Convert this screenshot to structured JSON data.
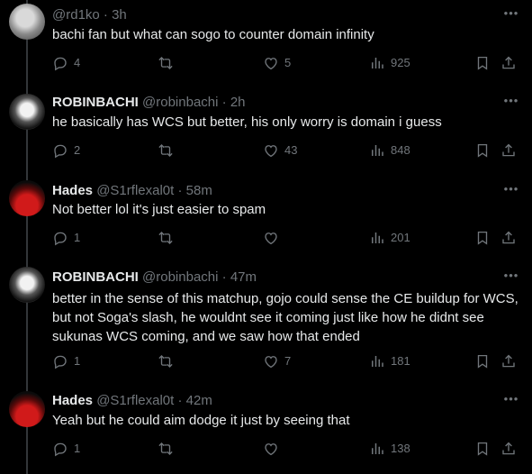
{
  "tweets": [
    {
      "name": "",
      "handle": "@rd1ko",
      "time": "3h",
      "text": "bachi fan but what can sogo to counter domain infinity",
      "replies": "4",
      "retweets": "",
      "likes": "5",
      "views": "925"
    },
    {
      "name": "ROBINBACHI",
      "handle": "@robinbachi",
      "time": "2h",
      "text": "he basically has WCS but better, his only worry is domain i guess",
      "replies": "2",
      "retweets": "",
      "likes": "43",
      "views": "848"
    },
    {
      "name": "Hades",
      "handle": "@S1rflexal0t",
      "time": "58m",
      "text": "Not better lol it's just easier to spam",
      "replies": "1",
      "retweets": "",
      "likes": "",
      "views": "201"
    },
    {
      "name": "ROBINBACHI",
      "handle": "@robinbachi",
      "time": "47m",
      "text": "better in the sense of this matchup, gojo could sense the CE buildup for WCS, but not Soga's slash, he wouldnt see it coming just like how he didnt see sukunas WCS coming, and we saw how that ended",
      "replies": "1",
      "retweets": "",
      "likes": "7",
      "views": "181"
    },
    {
      "name": "Hades",
      "handle": "@S1rflexal0t",
      "time": "42m",
      "text": "Yeah but he could aim dodge it just by seeing that",
      "replies": "1",
      "retweets": "",
      "likes": "",
      "views": "138"
    }
  ],
  "icons": {
    "reply": "reply-icon",
    "retweet": "retweet-icon",
    "like": "like-icon",
    "views": "views-icon",
    "bookmark": "bookmark-icon",
    "share": "share-icon",
    "more": "more-icon"
  },
  "colors": {
    "background": "#000000",
    "text": "#e7e9ea",
    "muted": "#71767b",
    "line": "#333639"
  }
}
